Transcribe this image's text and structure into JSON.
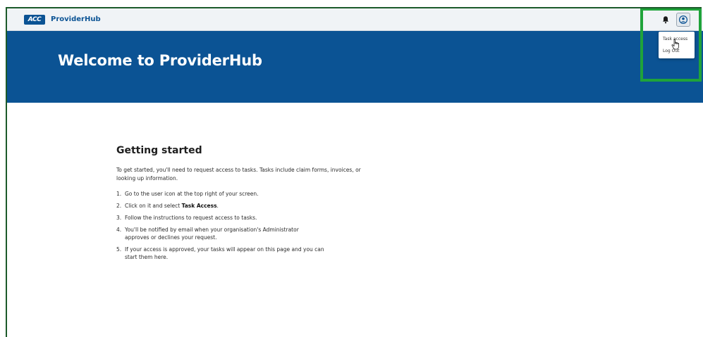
{
  "header": {
    "logo_text": "ACC",
    "brand": "ProviderHub",
    "notifications_icon": "bell-icon",
    "user_icon": "user-circle-icon"
  },
  "user_menu": {
    "items": [
      {
        "label": "Task access"
      },
      {
        "label": "Log Out"
      }
    ]
  },
  "hero": {
    "title": "Welcome to ProviderHub",
    "background": "#0b5394"
  },
  "getting_started": {
    "title": "Getting started",
    "intro": "To get started, you'll need to request access to tasks. Tasks include claim forms, invoices, or looking up information.",
    "steps": [
      {
        "num": "1.",
        "text": "Go to the user icon at the top right of your screen."
      },
      {
        "num": "2.",
        "text_before": "Click on it and select ",
        "bold": "Task Access",
        "text_after": "."
      },
      {
        "num": "3.",
        "text": "Follow the instructions to request access to tasks."
      },
      {
        "num": "4.",
        "text": "You'll be notified by email when your organisation's Administrator approves or declines  your request."
      },
      {
        "num": "5.",
        "text": "If your access is approved, your tasks will appear on this page and you can start them here."
      }
    ]
  },
  "colors": {
    "highlight": "#1fa33a",
    "brand_blue": "#0b5394",
    "border": "#1c5a2a"
  }
}
